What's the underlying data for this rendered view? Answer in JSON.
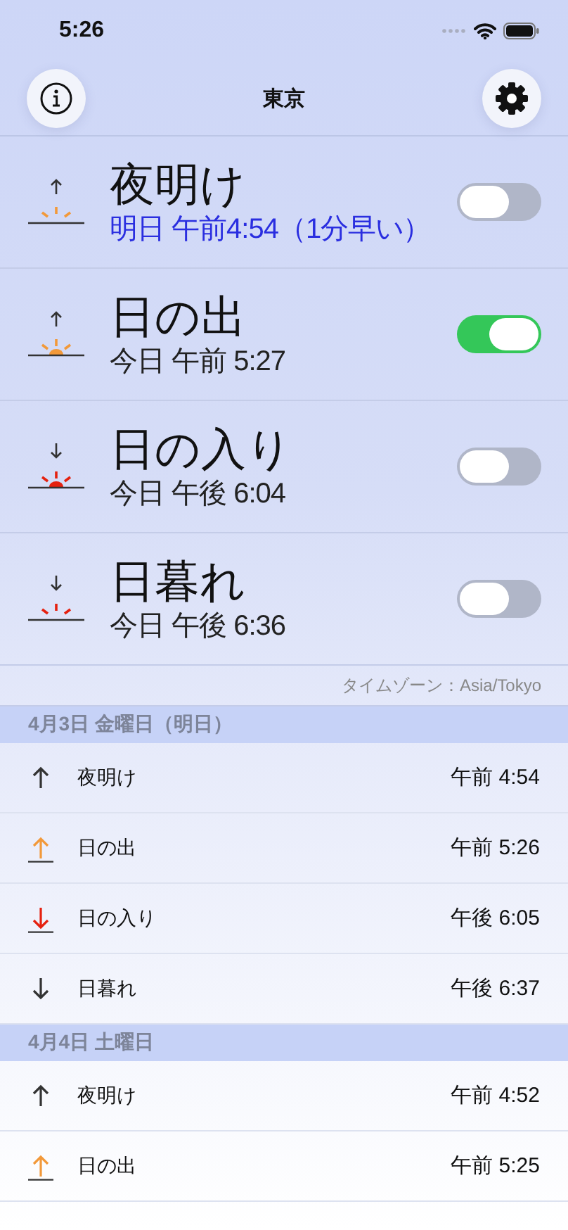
{
  "status_bar": {
    "time": "5:26"
  },
  "nav": {
    "title": "東京"
  },
  "events": [
    {
      "kind": "dawn",
      "title": "夜明け",
      "time": "明日 午前4:54（1分早い）",
      "next": true,
      "on": false
    },
    {
      "kind": "sunrise",
      "title": "日の出",
      "time": "今日 午前 5:27",
      "next": false,
      "on": true
    },
    {
      "kind": "sunset",
      "title": "日の入り",
      "time": "今日 午後 6:04",
      "next": false,
      "on": false
    },
    {
      "kind": "dusk",
      "title": "日暮れ",
      "time": "今日 午後 6:36",
      "next": false,
      "on": false
    }
  ],
  "timezone": "タイムゾーン：Asia/Tokyo",
  "days": [
    {
      "heading": "4月3日 金曜日（明日）",
      "rows": [
        {
          "kind": "dawn",
          "label": "夜明け",
          "time": "午前 4:54"
        },
        {
          "kind": "sunrise",
          "label": "日の出",
          "time": "午前 5:26"
        },
        {
          "kind": "sunset",
          "label": "日の入り",
          "time": "午後 6:05"
        },
        {
          "kind": "dusk",
          "label": "日暮れ",
          "time": "午後 6:37"
        }
      ]
    },
    {
      "heading": "4月4日 土曜日",
      "rows": [
        {
          "kind": "dawn",
          "label": "夜明け",
          "time": "午前 4:52"
        },
        {
          "kind": "sunrise",
          "label": "日の出",
          "time": "午前 5:25"
        }
      ]
    }
  ]
}
